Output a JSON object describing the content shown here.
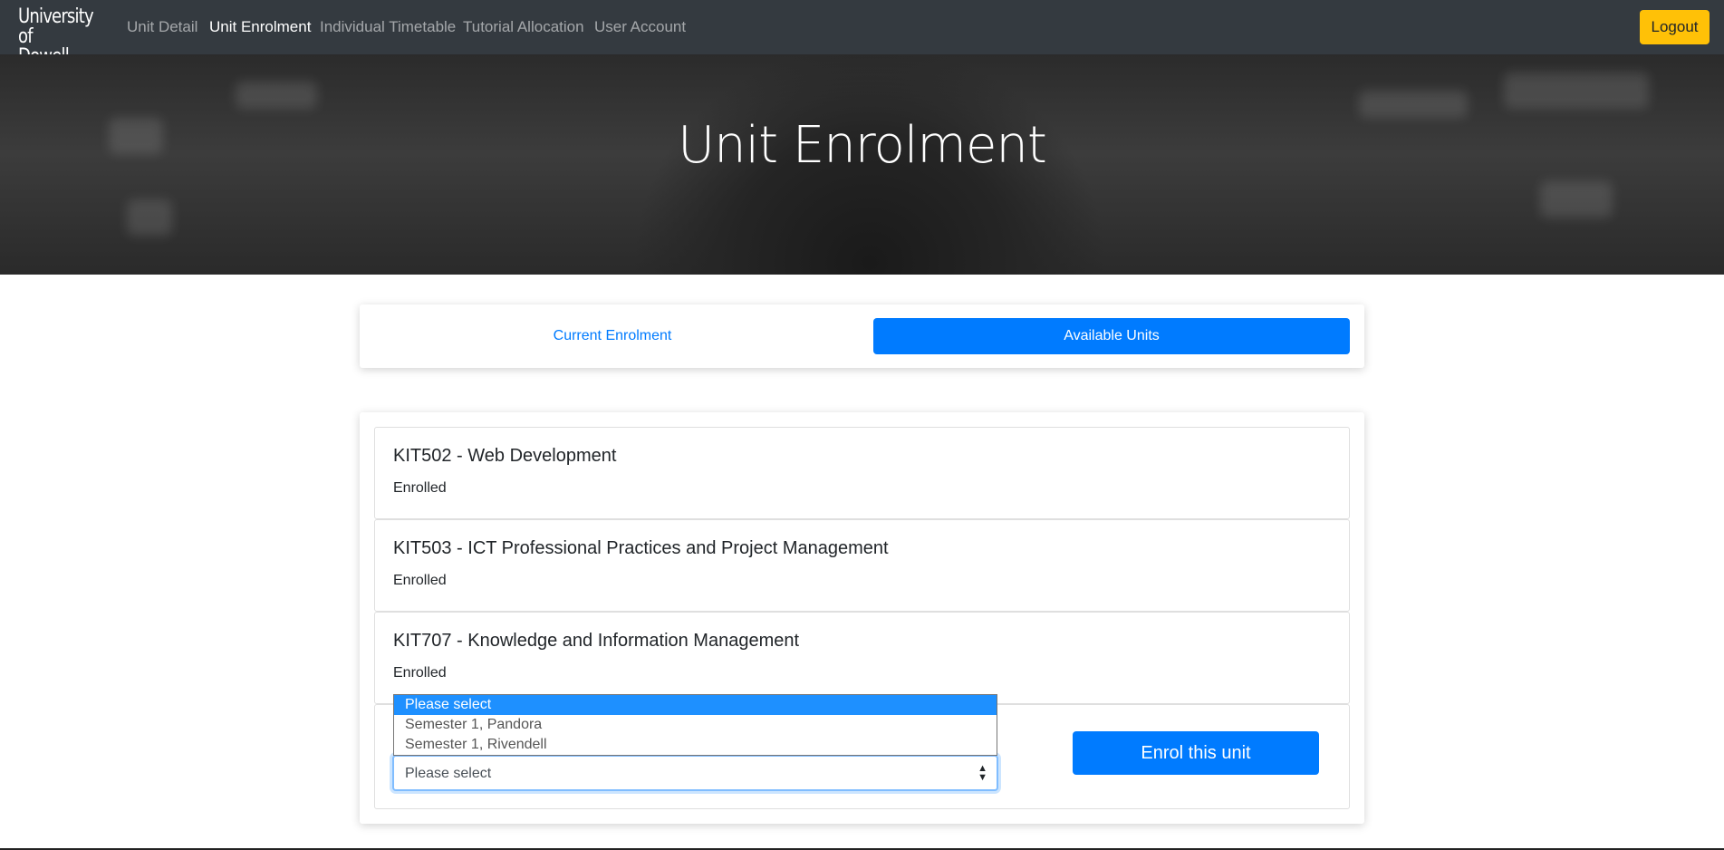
{
  "brand": {
    "line1": "University",
    "line2": "of Dowell"
  },
  "nav": {
    "items": [
      {
        "label": "Unit Detail",
        "active": false
      },
      {
        "label": "Unit Enrolment",
        "active": true
      },
      {
        "label": "Individual Timetable",
        "active": false
      },
      {
        "label": "Tutorial Allocation",
        "active": false
      },
      {
        "label": "User Account",
        "active": false
      }
    ],
    "logout_label": "Logout"
  },
  "hero": {
    "title": "Unit Enrolment"
  },
  "tabs": [
    {
      "label": "Current Enrolment",
      "active": false
    },
    {
      "label": "Available Units",
      "active": true
    }
  ],
  "units": [
    {
      "title": "KIT502 - Web Development",
      "status": "Enrolled"
    },
    {
      "title": "KIT503 - ICT Professional Practices and Project Management",
      "status": "Enrolled"
    },
    {
      "title": "KIT707 - Knowledge and Information Management",
      "status": "Enrolled"
    }
  ],
  "enrol": {
    "select_value": "Please select",
    "options": [
      "Please select",
      "Semester 1, Pandora",
      "Semester 1, Rivendell"
    ],
    "highlighted_option": "Please select",
    "button_label": "Enrol this unit"
  },
  "colors": {
    "navbar": "#343a40",
    "primary": "#007bff",
    "logout": "#ffc107",
    "option_highlight": "#1e90ff"
  }
}
